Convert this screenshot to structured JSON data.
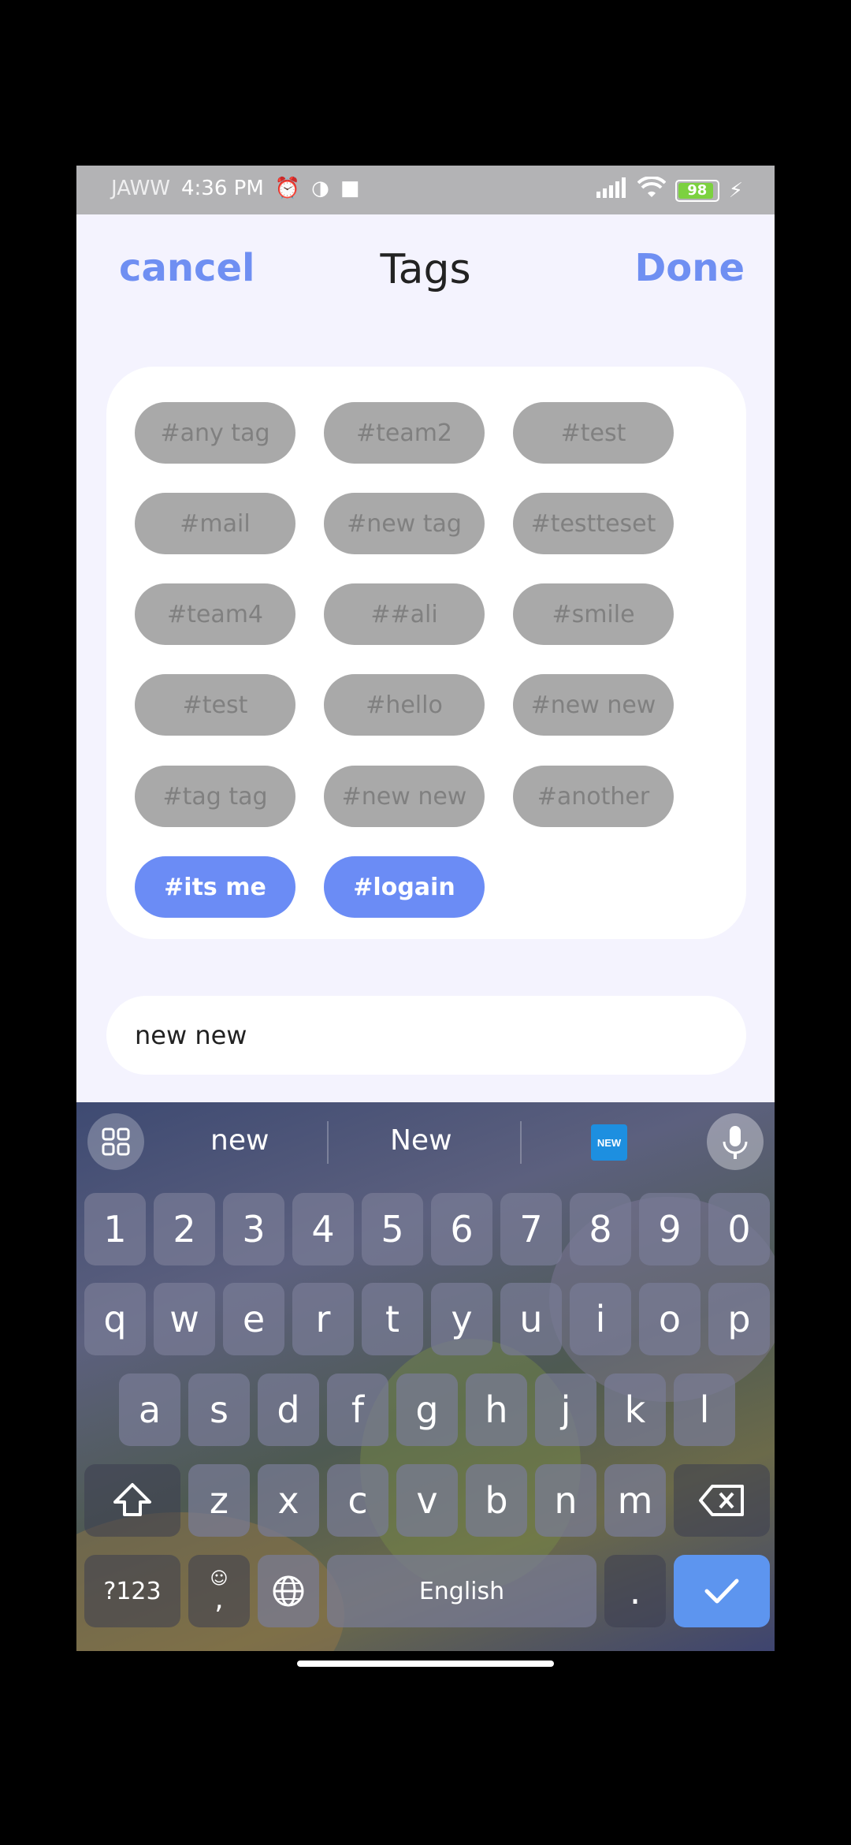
{
  "status_bar": {
    "carrier": "JAWW",
    "time": "4:36 PM",
    "battery": "98",
    "icons": [
      "alarm-icon",
      "data-saver-icon",
      "video-camera-icon",
      "signal-icon",
      "wifi-icon",
      "battery-icon",
      "charging-icon"
    ]
  },
  "header": {
    "cancel_label": "cancel",
    "title": "Tags",
    "done_label": "Done"
  },
  "tags": [
    {
      "label": "#any tag",
      "selected": false
    },
    {
      "label": "#team2",
      "selected": false
    },
    {
      "label": "#test",
      "selected": false
    },
    {
      "label": "#mail",
      "selected": false
    },
    {
      "label": "#new tag",
      "selected": false
    },
    {
      "label": "#testteset",
      "selected": false
    },
    {
      "label": "#team4",
      "selected": false
    },
    {
      "label": "##ali",
      "selected": false
    },
    {
      "label": "#smile",
      "selected": false
    },
    {
      "label": "#test",
      "selected": false
    },
    {
      "label": "#hello",
      "selected": false
    },
    {
      "label": "#new new",
      "selected": false
    },
    {
      "label": "#tag tag",
      "selected": false
    },
    {
      "label": "#new new",
      "selected": false
    },
    {
      "label": "#another",
      "selected": false
    },
    {
      "label": "#its me",
      "selected": true
    },
    {
      "label": "#logain",
      "selected": true
    }
  ],
  "input": {
    "value": "new new"
  },
  "keyboard": {
    "suggestions": [
      "new",
      "New"
    ],
    "new_badge": "NEW",
    "number_row": [
      "1",
      "2",
      "3",
      "4",
      "5",
      "6",
      "7",
      "8",
      "9",
      "0"
    ],
    "row1": [
      "q",
      "w",
      "e",
      "r",
      "t",
      "y",
      "u",
      "i",
      "o",
      "p"
    ],
    "row2": [
      "a",
      "s",
      "d",
      "f",
      "g",
      "h",
      "j",
      "k",
      "l"
    ],
    "row3": [
      "z",
      "x",
      "c",
      "v",
      "b",
      "n",
      "m"
    ],
    "symbols_label": "?123",
    "comma_label": ",",
    "space_label": "English",
    "period_label": "."
  },
  "colors": {
    "accent": "#6b8cf5",
    "tag_unselected_bg": "#a9a9a9",
    "enter_key": "#5d95ef"
  }
}
